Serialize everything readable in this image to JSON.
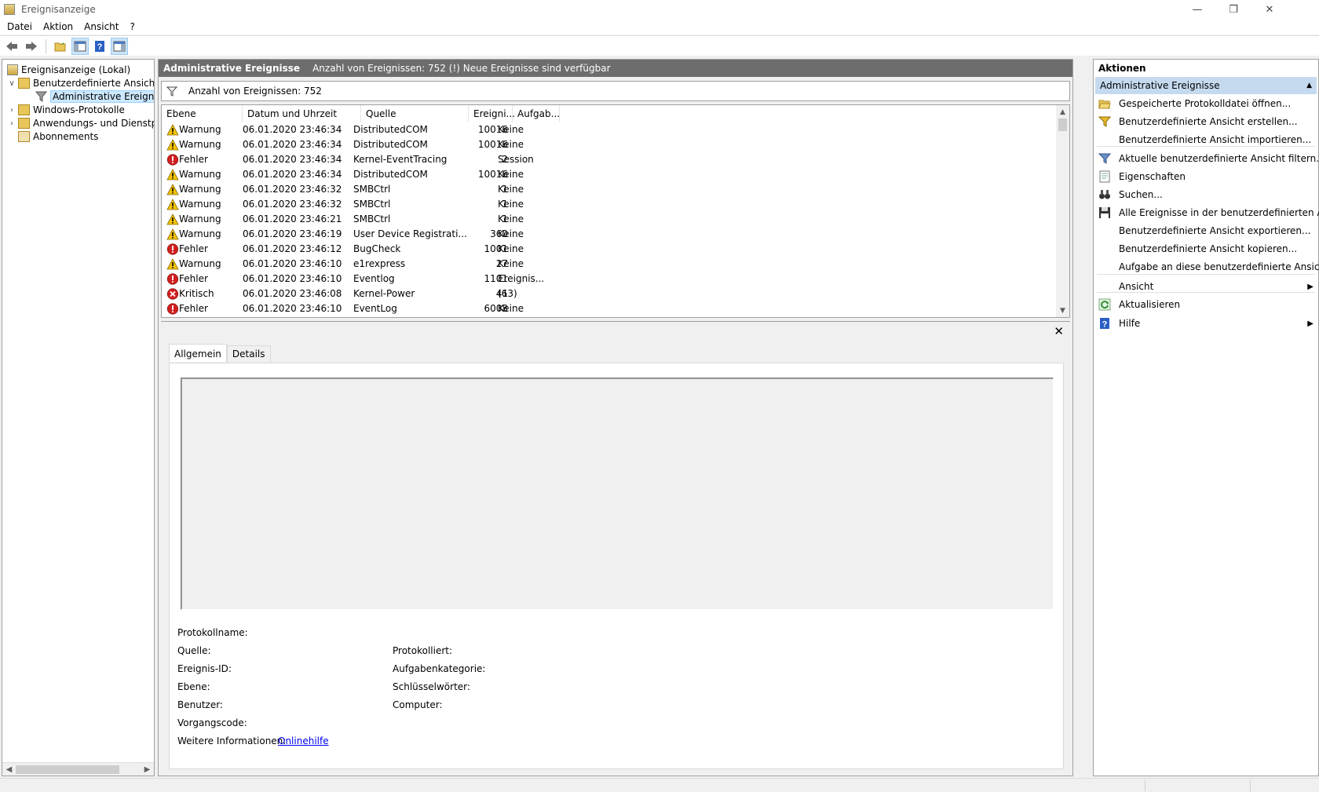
{
  "window": {
    "title": "Ereignisanzeige"
  },
  "menu": [
    "Datei",
    "Aktion",
    "Ansicht",
    "?"
  ],
  "toolbar": {
    "buttons": [
      "back-arrow-icon",
      "forward-arrow-icon",
      "open-folder-icon",
      "show-hide-console-tree-icon",
      "help-icon",
      "show-hide-action-pane-icon"
    ]
  },
  "tree": {
    "root": "Ereignisanzeige (Lokal)",
    "custom_views": "Benutzerdefinierte Ansichten",
    "admin_events": "Administrative Ereignisse",
    "windows_logs": "Windows-Protokolle",
    "app_service_logs": "Anwendungs- und Dienstprotokolle",
    "subscriptions": "Abonnements"
  },
  "center": {
    "header_title": "Administrative Ereignisse",
    "header_info": "Anzahl von Ereignissen: 752 (!) Neue Ereignisse sind verfügbar",
    "filter_text": "Anzahl von Ereignissen: 752",
    "columns": [
      "Ebene",
      "Datum und Uhrzeit",
      "Quelle",
      "Ereigni...",
      "Aufgab..."
    ],
    "rows": [
      {
        "level": "Warnung",
        "type": "warning",
        "date": "06.01.2020 23:46:34",
        "source": "DistributedCOM",
        "id": "10016",
        "task": "Keine"
      },
      {
        "level": "Warnung",
        "type": "warning",
        "date": "06.01.2020 23:46:34",
        "source": "DistributedCOM",
        "id": "10016",
        "task": "Keine"
      },
      {
        "level": "Fehler",
        "type": "error",
        "date": "06.01.2020 23:46:34",
        "source": "Kernel-EventTracing",
        "id": "2",
        "task": "Session"
      },
      {
        "level": "Warnung",
        "type": "warning",
        "date": "06.01.2020 23:46:34",
        "source": "DistributedCOM",
        "id": "10016",
        "task": "Keine"
      },
      {
        "level": "Warnung",
        "type": "warning",
        "date": "06.01.2020 23:46:32",
        "source": "SMBCtrl",
        "id": "1",
        "task": "Keine"
      },
      {
        "level": "Warnung",
        "type": "warning",
        "date": "06.01.2020 23:46:32",
        "source": "SMBCtrl",
        "id": "1",
        "task": "Keine"
      },
      {
        "level": "Warnung",
        "type": "warning",
        "date": "06.01.2020 23:46:21",
        "source": "SMBCtrl",
        "id": "1",
        "task": "Keine"
      },
      {
        "level": "Warnung",
        "type": "warning",
        "date": "06.01.2020 23:46:19",
        "source": "User Device Registrati...",
        "id": "360",
        "task": "Keine"
      },
      {
        "level": "Fehler",
        "type": "error",
        "date": "06.01.2020 23:46:12",
        "source": "BugCheck",
        "id": "1001",
        "task": "Keine"
      },
      {
        "level": "Warnung",
        "type": "warning",
        "date": "06.01.2020 23:46:10",
        "source": "e1rexpress",
        "id": "27",
        "task": "Keine"
      },
      {
        "level": "Fehler",
        "type": "error",
        "date": "06.01.2020 23:46:10",
        "source": "Eventlog",
        "id": "1101",
        "task": "Ereignis..."
      },
      {
        "level": "Kritisch",
        "type": "critical",
        "date": "06.01.2020 23:46:08",
        "source": "Kernel-Power",
        "id": "41",
        "task": "(63)"
      },
      {
        "level": "Fehler",
        "type": "error",
        "date": "06.01.2020 23:46:10",
        "source": "EventLog",
        "id": "6008",
        "task": "Keine"
      }
    ]
  },
  "detail": {
    "tabs": [
      "Allgemein",
      "Details"
    ],
    "fields": {
      "log_name": "Protokollname:",
      "source": "Quelle:",
      "logged": "Protokolliert:",
      "event_id": "Ereignis-ID:",
      "task_category": "Aufgabenkategorie:",
      "level": "Ebene:",
      "keywords": "Schlüsselwörter:",
      "user": "Benutzer:",
      "computer": "Computer:",
      "opcode": "Vorgangscode:",
      "more_info": "Weitere Informationen:",
      "online_help": "Onlinehilfe"
    }
  },
  "actions": {
    "title": "Aktionen",
    "section": "Administrative Ereignisse",
    "items": [
      {
        "label": "Gespeicherte Protokolldatei öffnen...",
        "icon": "open-folder-icon"
      },
      {
        "label": "Benutzerdefinierte Ansicht erstellen...",
        "icon": "filter-create-icon"
      },
      {
        "label": "Benutzerdefinierte Ansicht importieren...",
        "icon": ""
      },
      {
        "label": "Aktuelle benutzerdefinierte Ansicht filtern...",
        "icon": "filter-icon"
      },
      {
        "label": "Eigenschaften",
        "icon": "properties-icon"
      },
      {
        "label": "Suchen...",
        "icon": "binoculars-icon"
      },
      {
        "label": "Alle Ereignisse in der benutzerdefinierten Ansi...",
        "icon": "save-icon"
      },
      {
        "label": "Benutzerdefinierte Ansicht exportieren...",
        "icon": ""
      },
      {
        "label": "Benutzerdefinierte Ansicht kopieren...",
        "icon": ""
      },
      {
        "label": "Aufgabe an diese benutzerdefinierte Ansicht a...",
        "icon": ""
      },
      {
        "label": "Ansicht",
        "icon": ""
      },
      {
        "label": "Aktualisieren",
        "icon": "refresh-icon"
      },
      {
        "label": "Hilfe",
        "icon": "help-icon"
      }
    ]
  },
  "colors": {
    "header_bg": "#6d6d6d",
    "action_section_bg": "#c5daef",
    "selection_bg": "#cce8ff",
    "warning": "#f5c400",
    "error": "#d11f1f",
    "link": "#0000ee"
  }
}
